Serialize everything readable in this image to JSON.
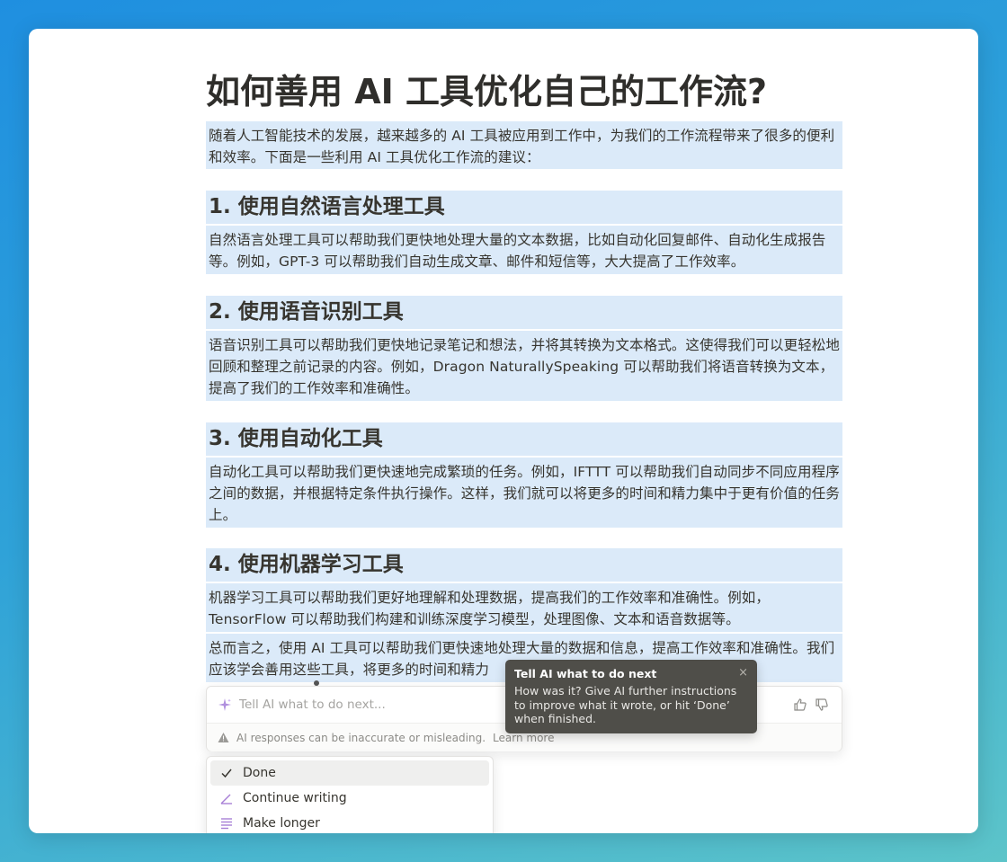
{
  "doc": {
    "title": "如何善用 AI 工具优化自己的工作流?",
    "intro": "随着人工智能技术的发展，越来越多的 AI 工具被应用到工作中，为我们的工作流程带来了很多的便利和效率。下面是一些利用 AI 工具优化工作流的建议：",
    "sections": [
      {
        "heading": "1. 使用自然语言处理工具",
        "body": "自然语言处理工具可以帮助我们更快地处理大量的文本数据，比如自动化回复邮件、自动化生成报告等。例如，GPT-3 可以帮助我们自动生成文章、邮件和短信等，大大提高了工作效率。"
      },
      {
        "heading": "2. 使用语音识别工具",
        "body": "语音识别工具可以帮助我们更快地记录笔记和想法，并将其转换为文本格式。这使得我们可以更轻松地回顾和整理之前记录的内容。例如，Dragon NaturallySpeaking 可以帮助我们将语音转换为文本，提高了我们的工作效率和准确性。"
      },
      {
        "heading": "3. 使用自动化工具",
        "body": "自动化工具可以帮助我们更快速地完成繁琐的任务。例如，IFTTT 可以帮助我们自动同步不同应用程序之间的数据，并根据特定条件执行操作。这样，我们就可以将更多的时间和精力集中于更有价值的任务上。"
      },
      {
        "heading": "4. 使用机器学习工具",
        "body": "机器学习工具可以帮助我们更好地理解和处理数据，提高我们的工作效率和准确性。例如，TensorFlow 可以帮助我们构建和训练深度学习模型，处理图像、文本和语音数据等。"
      }
    ],
    "conclusion": "总而言之，使用 AI 工具可以帮助我们更快速地处理大量的数据和信息，提高工作效率和准确性。我们应该学会善用这些工具，将更多的时间和精力"
  },
  "ai_prompt": {
    "placeholder": "Tell AI what to do next...",
    "disclaimer": "AI responses can be inaccurate or misleading.",
    "learn_more": "Learn more"
  },
  "tooltip": {
    "title": "Tell AI what to do next",
    "body": "How was it? Give AI further instructions to improve what it wrote, or hit ‘Done’ when finished.",
    "close": "×"
  },
  "menu": {
    "items": [
      {
        "label": "Done",
        "icon": "check-icon"
      },
      {
        "label": "Continue writing",
        "icon": "pen-icon"
      },
      {
        "label": "Make longer",
        "icon": "lines-icon"
      }
    ]
  },
  "colors": {
    "highlight": "#dbeaf9",
    "text": "#37352f",
    "tooltip_bg": "#4f4e49",
    "accent_purple": "#a77fd6"
  }
}
